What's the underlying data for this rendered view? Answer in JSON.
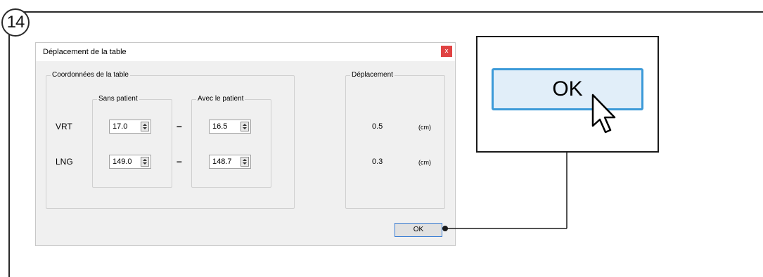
{
  "step": "14",
  "dialog": {
    "title": "Déplacement de la table",
    "close_label": "x",
    "coordinates_group": "Coordonnées de la table",
    "without_patient_group": "Sans patient",
    "with_patient_group": "Avec le patient",
    "displacement_group": "Déplacement",
    "rows": [
      {
        "label": "VRT",
        "sans_patient": "17.0",
        "avec_patient": "16.5",
        "displacement": "0.5",
        "unit": "(cm)"
      },
      {
        "label": "LNG",
        "sans_patient": "149.0",
        "avec_patient": "148.7",
        "displacement": "0.3",
        "unit": "(cm)"
      }
    ],
    "separator": "–",
    "ok_label": "OK"
  },
  "zoom": {
    "ok_label": "OK"
  },
  "colors": {
    "close_button": "#e04343",
    "focus_blue": "#3c9ad8"
  }
}
